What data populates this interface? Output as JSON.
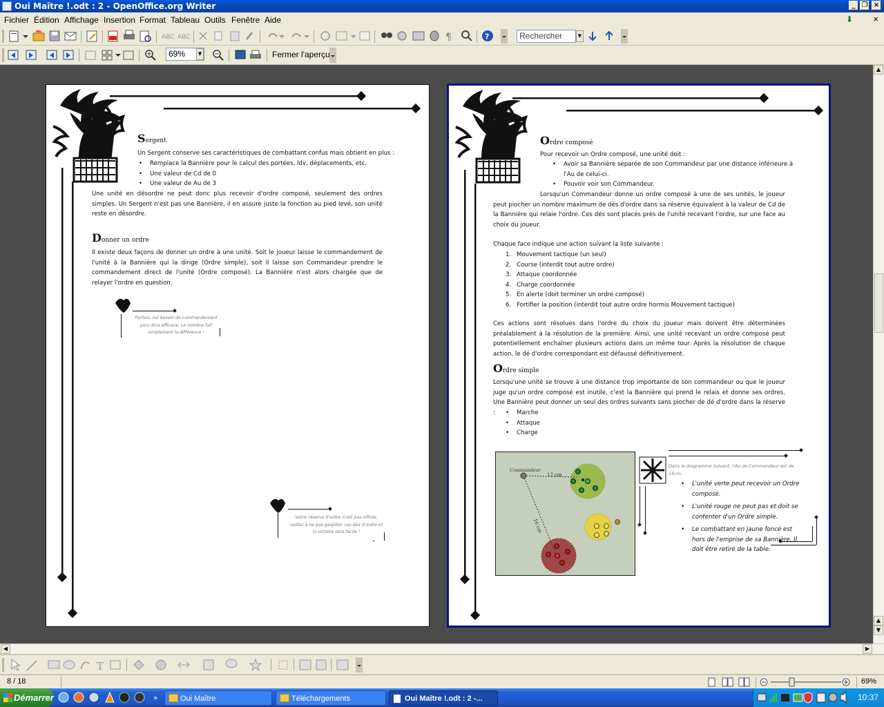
{
  "window": {
    "title": "Oui Maître !.odt : 2 - OpenOffice.org Writer"
  },
  "menu": [
    "Fichier",
    "Édition",
    "Affichage",
    "Insertion",
    "Format",
    "Tableau",
    "Outils",
    "Fenêtre",
    "Aide"
  ],
  "toolbar": {
    "search_placeholder": "Rechercher"
  },
  "preview_bar": {
    "zoom": "69%",
    "close_label": "Fermer l'aperçu"
  },
  "page1": {
    "h_sergent": "ergent",
    "h_sergent_cap": "S",
    "p1": "Un Sergent conserve ses caractéristiques de combattant confus mais obtient en plus :",
    "list1": [
      "Remplace la Bannière pour le calcul des portées, ldv, déplacements, etc.",
      "Une valeur de Cd de 0",
      "Une valeur de Au de 3"
    ],
    "p2": "Une unité en désordre ne peut donc plus recevoir d'ordre composé, seulement des ordres simples. Un Sergent n'est pas une Bannière, il en assure juste la fonction au pied levé, son unité reste en désordre.",
    "h_donner": "onner un ordre",
    "h_donner_cap": "D",
    "p3": "Il existe deux façons de donner un ordre à une unité. Soit le joueur laisse le commandement de l'unité à la Bannière qui la dirige (Ordre simple), soit il laisse son Commandeur prendre le commandement direct de l'unité (Ordre composé). La Bannière n'est alors chargée que de relayer l'ordre en question.",
    "note1": "Parfois, nul besoin de commandement pour être efficace. Le nombre fait simplement la différence !",
    "note2": "Votre réserve d'ordre n'est pas infinie, veillez à ne pas gaspiller vos dés d'ordre et la victoire sera facile !"
  },
  "page2": {
    "h_compose": "rdre composé",
    "h_compose_cap": "O",
    "p1": "Pour recevoir un Ordre composé, une unité doit :",
    "list1": [
      "Avoir sa Bannière séparée de son Commandeur par une distance inférieure à",
      "l'Au de celui-ci.",
      "Pouvoir voir son Commandeur."
    ],
    "p2": "Lorsqu'un Commandeur donne un ordre composé à une de ses unités, le joueur peut piocher un nombre maximum de dés d'ordre dans sa réserve équivalent à la valeur de Cd de la Bannière qui relaie l'ordre. Ces dés sont placés près de l'unité recevant l'ordre, sur une face au choix du joueur.",
    "p3": "Chaque face indique une action suivant la liste suivante :",
    "list2": [
      "Mouvement tactique (un seul)",
      "Course (interdit tout autre ordre)",
      "Attaque coordonnée",
      "Charge coordonnée",
      "En alerte (doit terminer un ordre composé)",
      "Fortifier la position (interdit tout autre ordre hormis Mouvement tactique)"
    ],
    "p4": "Ces actions sont résolues dans l'ordre du choix du joueur mais doivent être déterminées préalablement à la résolution de la première. Ainsi, une unité recevant un ordre composé peut potentiellement enchaîner plusieurs actions dans un même tour. Après la résolution de chaque action, le dé d'ordre correspondant est défaussé définitivement.",
    "h_simple": "rdre simple",
    "h_simple_cap": "O",
    "p5": "Lorsqu'une unité se trouve à une distance trop importante de son commandeur ou que le joueur juge qu'un ordre composé est inutile, c'est la Bannière qui prend le relais et donne ses ordres. Une Bannière peut donner un seul des ordres suivants sans piocher de dé d'ordre dans la réserve :",
    "list3": [
      "Marche",
      "Attaque",
      "Charge"
    ],
    "diagram": {
      "commandeur": "Commandeur",
      "d1": "12 cm",
      "d2": "16 cm"
    },
    "legend_intro": "Dans le diagramme suivant, l'Au du Commandeur est de 15cm.",
    "legend": [
      "L'unité verte peut recevoir un Ordre composé.",
      "L'unité rouge ne peut pas et doit se contenter d'un Ordre simple.",
      "Le combattant en jaune foncé est hors de l'emprise de sa Bannière. Il doit être retiré de la table."
    ]
  },
  "status": {
    "page": "8 / 18",
    "zoom": "69%"
  },
  "taskbar": {
    "start": "Démarrer",
    "tasks": [
      "Oui Maître",
      "Téléchargements",
      "Oui Maître !.odt : 2 -..."
    ],
    "clock": "10:37"
  },
  "colors": {
    "title_bar": "#0a58d8",
    "page2_border": "#0a137e",
    "workspace": "#4b4b4b"
  }
}
